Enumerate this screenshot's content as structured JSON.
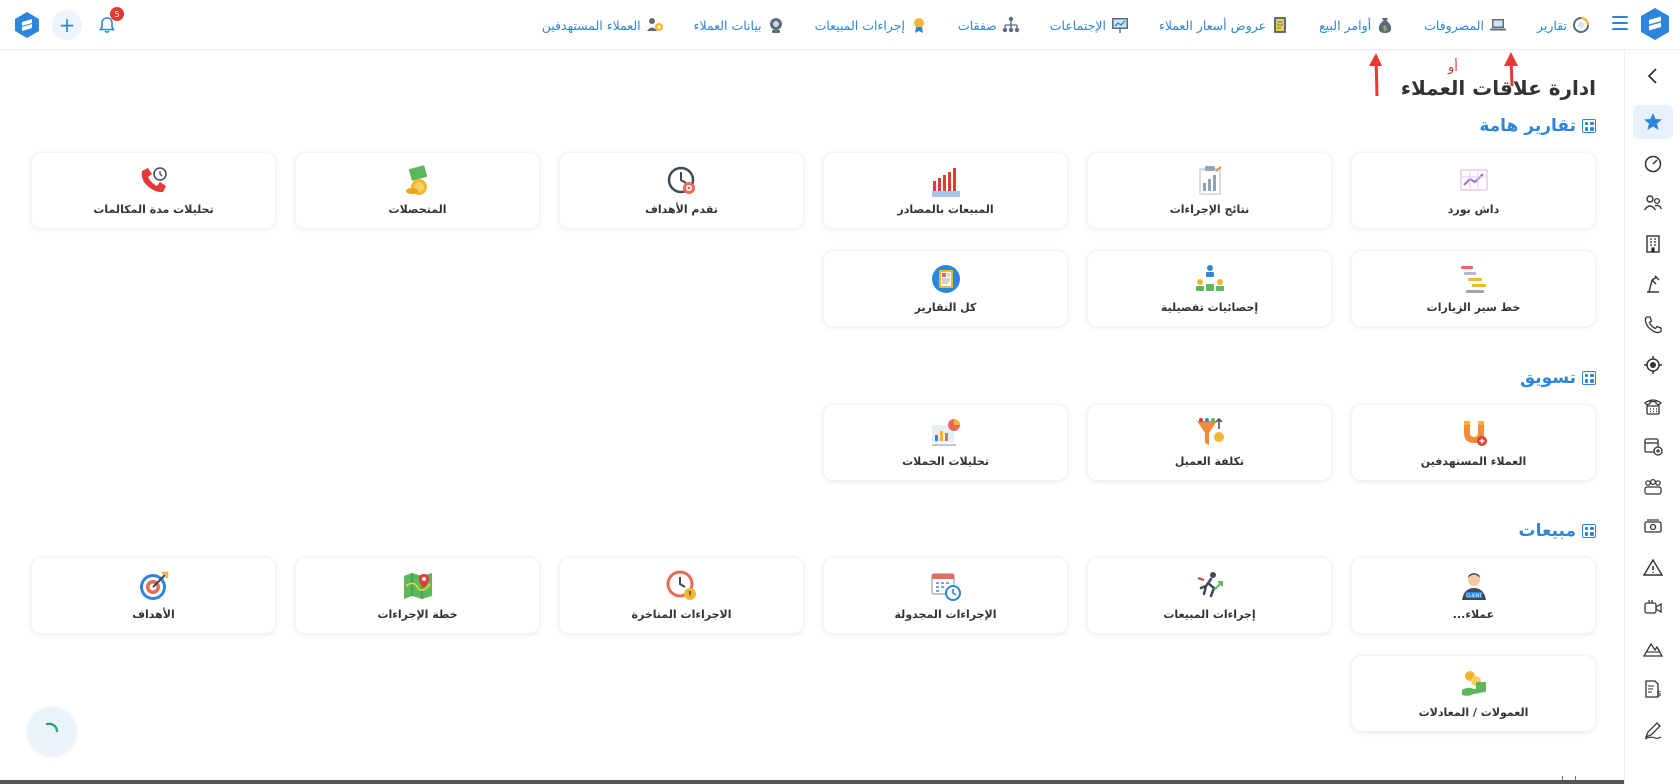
{
  "header": {
    "notification_count": "5",
    "nav": [
      {
        "label": "العملاء المستهدفين",
        "icon": "target-customers-icon"
      },
      {
        "label": "بيانات العملاء",
        "icon": "webcam-icon"
      },
      {
        "label": "إجراءات المبيعات",
        "icon": "award-icon"
      },
      {
        "label": "صفقات",
        "icon": "org-chart-icon"
      },
      {
        "label": "الإجتماعات",
        "icon": "presentation-icon"
      },
      {
        "label": "عروض أسعار العملاء",
        "icon": "quote-doc-icon"
      },
      {
        "label": "أوامر البيع",
        "icon": "money-bag-icon"
      },
      {
        "label": "المصروفات",
        "icon": "laptop-icon"
      },
      {
        "label": "تقارير",
        "icon": "chart-ring-icon"
      }
    ]
  },
  "annotation": {
    "or_text": "أو"
  },
  "page": {
    "title": "ادارة علاقات العملاء"
  },
  "sections": {
    "reports": {
      "title": "تقارير هامة",
      "cards": [
        {
          "label": "داش بورد"
        },
        {
          "label": "نتائج الإجراءات"
        },
        {
          "label": "المبيعات بالمصادر"
        },
        {
          "label": "تقدم الأهداف"
        },
        {
          "label": "المتحصلات"
        },
        {
          "label": "تحليلات مدة المكالمات"
        },
        {
          "label": "خط سير الزيارات"
        },
        {
          "label": "إحصائيات تفصيلية"
        },
        {
          "label": "كل التقارير"
        }
      ]
    },
    "marketing": {
      "title": "تسويق",
      "cards": [
        {
          "label": "العملاء المستهدفين"
        },
        {
          "label": "تكلفة العميل"
        },
        {
          "label": "تحليلات الحملات"
        }
      ]
    },
    "sales": {
      "title": "مبيعات",
      "cards": [
        {
          "label": "عملاء..."
        },
        {
          "label": "إجراءات المبيعات"
        },
        {
          "label": "الإجراءات المجدولة"
        },
        {
          "label": "الاجراءات المتاخرة"
        },
        {
          "label": "خطة الإجراءات"
        },
        {
          "label": "الأهداف"
        },
        {
          "label": "العمولات / المعادلات"
        }
      ]
    }
  },
  "colors": {
    "accent": "#2d86d9",
    "annotation": "#e53935"
  }
}
